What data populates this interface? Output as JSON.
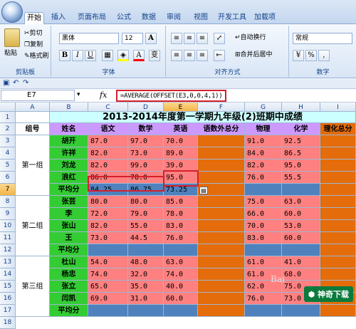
{
  "ribbon": {
    "tabs": [
      "开始",
      "插入",
      "页面布局",
      "公式",
      "数据",
      "审阅",
      "视图",
      "开发工具",
      "加载项"
    ],
    "clipboard": {
      "paste": "粘贴",
      "cut": "剪切",
      "copy": "复制",
      "format_painter": "格式刷",
      "label": "剪贴板"
    },
    "font": {
      "name": "黑体",
      "size": "12",
      "label": "字体",
      "bold": "B",
      "italic": "I",
      "underline": "U",
      "grow": "A",
      "shrink": "A",
      "color_a": "A",
      "phonetic": "变"
    },
    "alignment": {
      "wrap": "自动换行",
      "merge": "合并后居中",
      "label": "对齐方式"
    },
    "number": {
      "format": "常规",
      "label": "数字",
      "percent": "%",
      "comma": ","
    }
  },
  "formula_bar": {
    "cell_ref": "E7",
    "fx": "fx",
    "formula": "=AVERAGE(OFFSET(E3,0,0,4,1))"
  },
  "columns": [
    "A",
    "B",
    "C",
    "D",
    "E",
    "F",
    "G",
    "H",
    "I"
  ],
  "rows": [
    "1",
    "2",
    "3",
    "4",
    "5",
    "6",
    "7",
    "8",
    "9",
    "10",
    "11",
    "12",
    "13",
    "14",
    "15",
    "16",
    "17",
    "18"
  ],
  "title": "2013-2014年度第一学期九年级(2)班期中成绩",
  "headers": [
    "组号",
    "姓名",
    "语文",
    "数学",
    "英语",
    "语数外总分",
    "物理",
    "化学",
    "理化总分"
  ],
  "groups": [
    {
      "name": "第一组",
      "students": [
        {
          "name": "胡开",
          "chinese": "87.0",
          "math": "97.0",
          "english": "70.0",
          "physics": "91.0",
          "chemistry": "92.5"
        },
        {
          "name": "许祥",
          "chinese": "82.0",
          "math": "73.0",
          "english": "89.0",
          "physics": "84.0",
          "chemistry": "86.5"
        },
        {
          "name": "刘龙",
          "chinese": "82.0",
          "math": "99.0",
          "english": "39.0",
          "physics": "82.0",
          "chemistry": "95.0"
        },
        {
          "name": "浪红",
          "chinese": "86.0",
          "math": "78.0",
          "english": "95.0",
          "physics": "76.0",
          "chemistry": "55.5"
        }
      ],
      "avg": {
        "label": "平均分",
        "chinese": "84.25",
        "math": "86.75",
        "english": "73.25"
      }
    },
    {
      "name": "第二组",
      "students": [
        {
          "name": "张芸",
          "chinese": "80.0",
          "math": "80.0",
          "english": "85.0",
          "physics": "75.0",
          "chemistry": "63.0"
        },
        {
          "name": "李",
          "chinese": "72.0",
          "math": "79.0",
          "english": "78.0",
          "physics": "66.0",
          "chemistry": "60.0"
        },
        {
          "name": "张山",
          "chinese": "82.0",
          "math": "55.0",
          "english": "83.0",
          "physics": "70.0",
          "chemistry": "53.0"
        },
        {
          "name": "王",
          "chinese": "73.0",
          "math": "44.5",
          "english": "76.0",
          "physics": "83.0",
          "chemistry": "60.0"
        }
      ],
      "avg": {
        "label": "平均分",
        "chinese": "",
        "math": "",
        "english": ""
      }
    },
    {
      "name": "第三组",
      "students": [
        {
          "name": "杜山",
          "chinese": "54.0",
          "math": "48.0",
          "english": "63.0",
          "physics": "61.0",
          "chemistry": "41.0"
        },
        {
          "name": "杨忠",
          "chinese": "74.0",
          "math": "32.0",
          "english": "74.0",
          "physics": "61.0",
          "chemistry": "68.0"
        },
        {
          "name": "张立",
          "chinese": "65.0",
          "math": "35.0",
          "english": "40.0",
          "physics": "62.0",
          "chemistry": "75.0"
        },
        {
          "name": "闫凯",
          "chinese": "69.0",
          "math": "31.0",
          "english": "60.0",
          "physics": "76.0",
          "chemistry": "73.0"
        }
      ],
      "avg": {
        "label": "平均分",
        "chinese": "",
        "math": "",
        "english": ""
      }
    }
  ],
  "watermark": "神奇下载",
  "watermark2": "Bai",
  "colors": {
    "name_green": "#33cc33",
    "score_pink": "#ff8080",
    "avg_blue": "#4f81bd",
    "purple": "#cc99ff",
    "orange": "#e46c0a",
    "title_cyan": "#ccffff"
  }
}
